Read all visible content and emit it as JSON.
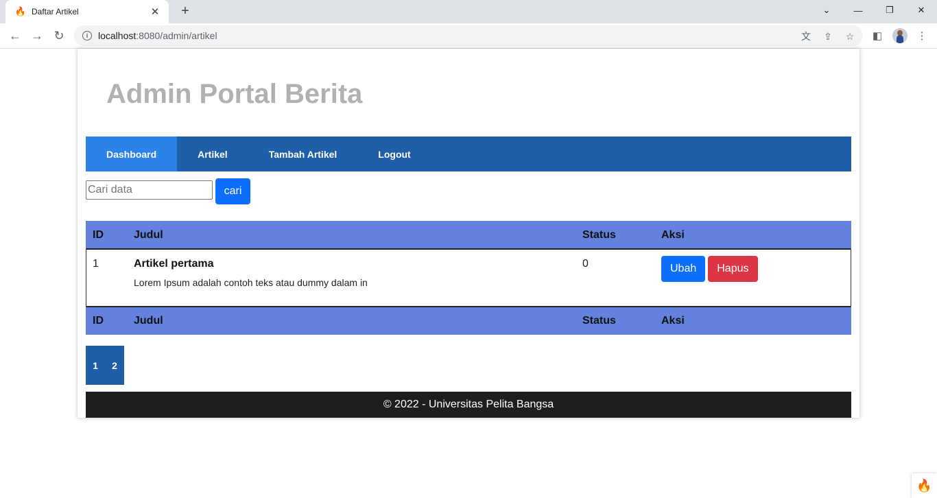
{
  "browser": {
    "tab_title": "Daftar Artikel",
    "url_host": "localhost",
    "url_rest": ":8080/admin/artikel",
    "accent": "#1f5faa"
  },
  "site": {
    "title": "Admin Portal Berita",
    "nav": [
      {
        "label": "Dashboard"
      },
      {
        "label": "Artikel"
      },
      {
        "label": "Tambah Artikel"
      },
      {
        "label": "Logout"
      }
    ],
    "search_placeholder": "Cari data",
    "search_button": "cari"
  },
  "table": {
    "headers": [
      "ID",
      "Judul",
      "Status",
      "Aksi"
    ],
    "rows": [
      {
        "id": "1",
        "title": "Artikel pertama",
        "desc": "Lorem Ipsum adalah contoh teks atau dummy dalam in",
        "status": "0",
        "edit_label": "Ubah",
        "delete_label": "Hapus"
      }
    ]
  },
  "pagination": [
    "1",
    "2"
  ],
  "footer": "© 2022 - Universitas Pelita Bangsa"
}
